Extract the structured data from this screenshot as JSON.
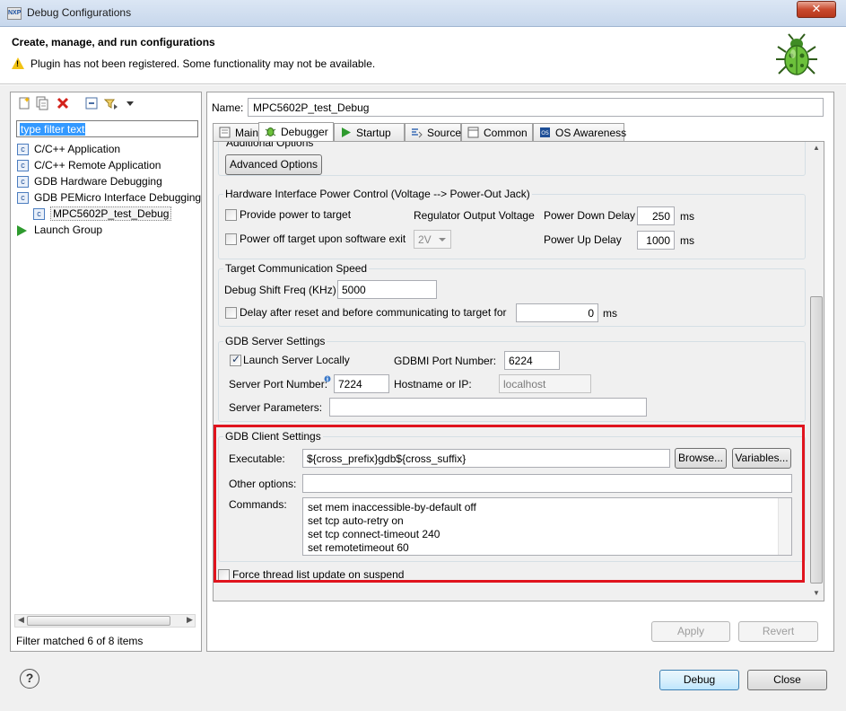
{
  "window": {
    "title": "Debug Configurations",
    "app_icon": "NXP",
    "close_glyph": "✕"
  },
  "header": {
    "title": "Create, manage, and run configurations",
    "message": "Plugin has not been registered. Some functionality may not be available.",
    "icons": {
      "warning": "warning-icon",
      "banner": "bug-icon"
    }
  },
  "left": {
    "toolbar_icons": [
      "new-config-icon",
      "duplicate-icon",
      "delete-icon",
      "collapse-all-icon",
      "filter-icon",
      "dropdown-icon"
    ],
    "filter_text": "type filter text",
    "tree": [
      {
        "label": "C/C++ Application",
        "icon": "c-icon",
        "indent": 0
      },
      {
        "label": "C/C++ Remote Application",
        "icon": "c-icon",
        "indent": 0
      },
      {
        "label": "GDB Hardware Debugging",
        "icon": "c-icon",
        "indent": 0
      },
      {
        "label": "GDB PEMicro Interface Debugging",
        "icon": "c-icon",
        "indent": 0
      },
      {
        "label": "MPC5602P_test_Debug",
        "icon": "c-icon",
        "indent": 1
      },
      {
        "label": "Launch Group",
        "icon": "play-icon",
        "indent": 0
      }
    ],
    "status": "Filter matched 6 of 8 items"
  },
  "config": {
    "name_label": "Name:",
    "name_value": "MPC5602P_test_Debug",
    "tabs": [
      {
        "label": "Main",
        "icon": "main-tab-icon"
      },
      {
        "label": "Debugger",
        "icon": "debugger-tab-icon",
        "active": true
      },
      {
        "label": "Startup",
        "icon": "startup-tab-icon"
      },
      {
        "label": "Source",
        "icon": "source-tab-icon"
      },
      {
        "label": "Common",
        "icon": "common-tab-icon"
      },
      {
        "label": "OS Awareness",
        "icon": "os-awareness-tab-icon"
      }
    ]
  },
  "additional": {
    "title": "Additional Options",
    "button": "Advanced Options"
  },
  "power": {
    "title": "Hardware Interface Power Control (Voltage --> Power-Out Jack)",
    "provide_power": "Provide power to target",
    "regulator_label": "Regulator Output Voltage",
    "power_off": "Power off target upon software exit",
    "voltage": "2V",
    "down_label": "Power Down Delay",
    "down_value": "250",
    "up_label": "Power Up Delay",
    "up_value": "1000",
    "unit": "ms"
  },
  "speed": {
    "title": "Target Communication Speed",
    "shift_label": "Debug Shift Freq (KHz)",
    "shift_value": "5000",
    "delay_label": "Delay after reset and before communicating to target for",
    "delay_value": "0",
    "unit": "ms"
  },
  "server": {
    "title": "GDB Server Settings",
    "launch_local": "Launch Server Locally",
    "launch_local_checked": true,
    "gdbmi_label": "GDBMI Port Number:",
    "gdbmi_value": "6224",
    "port_label": "Server Port Number:",
    "port_value": "7224",
    "host_label": "Hostname or IP:",
    "host_value": "localhost",
    "params_label": "Server Parameters:",
    "params_value": ""
  },
  "client": {
    "title": "GDB Client Settings",
    "exe_label": "Executable:",
    "exe_value": "${cross_prefix}gdb${cross_suffix}",
    "browse": "Browse...",
    "variables": "Variables...",
    "other_label": "Other options:",
    "other_value": "",
    "commands_label": "Commands:",
    "commands": [
      "set mem inaccessible-by-default off",
      "set tcp auto-retry on",
      "set tcp connect-timeout 240",
      "set remotetimeout 60"
    ],
    "force_thread": "Force thread list update on suspend",
    "highlight_color": "#e0141e"
  },
  "buttons": {
    "apply": "Apply",
    "revert": "Revert",
    "debug": "Debug",
    "close": "Close",
    "help": "?"
  }
}
